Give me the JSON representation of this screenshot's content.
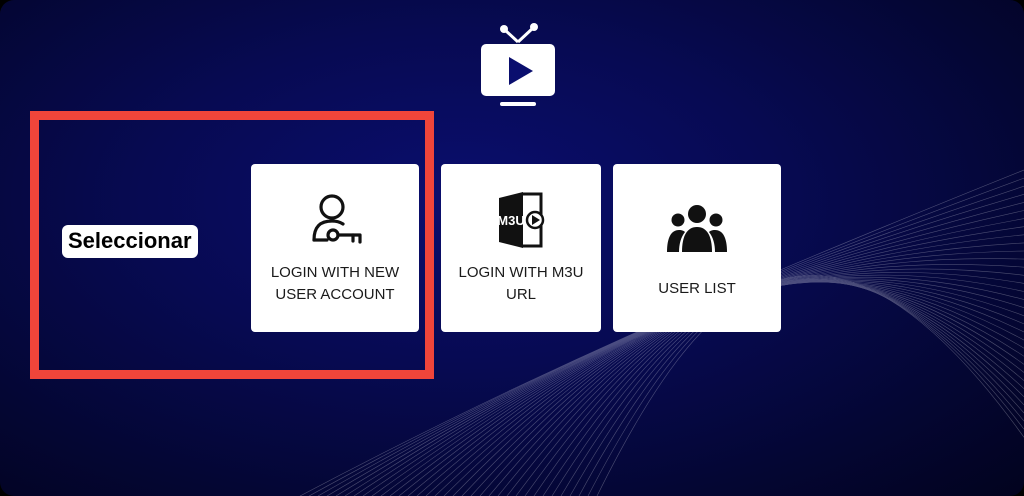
{
  "app": {
    "logo_icon": "tv-play-icon"
  },
  "menu": {
    "items": [
      {
        "id": "new-user",
        "label": "LOGIN WITH NEW\nUSER ACCOUNT",
        "icon": "user-key-icon",
        "selected": true
      },
      {
        "id": "m3u",
        "label": "LOGIN WITH M3U\nURL",
        "icon": "m3u-file-icon",
        "icon_text": "M3U",
        "selected": false
      },
      {
        "id": "user-list",
        "label": "USER LIST",
        "icon": "users-group-icon",
        "selected": false
      }
    ]
  },
  "overlay": {
    "badge_text": "Seleccionar",
    "highlight_color": "#f0453a"
  },
  "colors": {
    "background": "#070a52",
    "tile": "#ffffff",
    "icon": "#111111"
  }
}
